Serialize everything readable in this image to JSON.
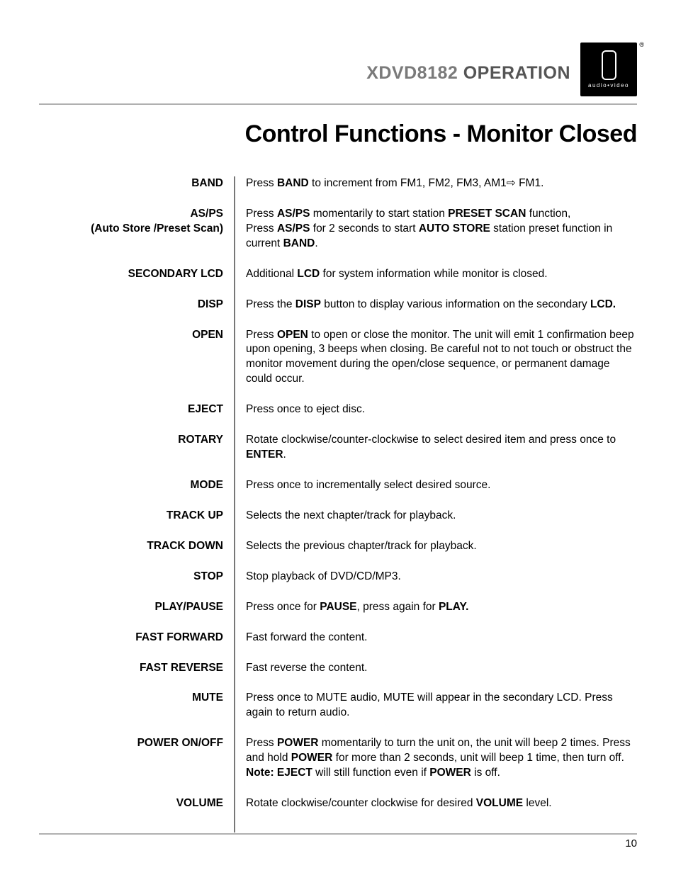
{
  "header": {
    "model": "XDVD8182",
    "section": "OPERATION",
    "logo_sub": "audio•video"
  },
  "title": "Control Functions - Monitor Closed",
  "rows": [
    {
      "label": "BAND",
      "desc": "Press <b>BAND</b> to increment from FM1, FM2, FM3, AM1<span class='arrow'>⇨</span> FM1."
    },
    {
      "label": "AS/PS<br><span class='sub'>(Auto Store /Preset Scan)</span>",
      "desc": "Press <b>AS/PS</b> momentarily to start station <b>PRESET SCAN</b> function,<br>Press <b>AS/PS</b> for 2 seconds to start <b>AUTO STORE</b> station preset function in current <b>BAND</b>."
    },
    {
      "label": "SECONDARY LCD",
      "desc": "Additional <b>LCD</b> for system information while monitor is closed."
    },
    {
      "label": "DISP",
      "desc": "Press the <b>DISP</b> button to display various information on the secondary <b>LCD.</b>"
    },
    {
      "label": "OPEN",
      "desc": "Press <b>OPEN</b> to open or close the monitor. The unit will emit 1 confirmation beep upon opening, 3 beeps when closing. Be careful not to not touch or obstruct the monitor movement during the open/close sequence, or permanent damage could occur."
    },
    {
      "label": "EJECT",
      "desc": "Press once to eject disc."
    },
    {
      "label": "ROTARY",
      "desc": "Rotate clockwise/counter-clockwise to select desired item and press once to <b>ENTER</b>."
    },
    {
      "label": "MODE",
      "desc": "Press once to incrementally select desired source."
    },
    {
      "label": "TRACK UP",
      "desc": "Selects the next chapter/track for playback."
    },
    {
      "label": "TRACK DOWN",
      "desc": "Selects the previous chapter/track for playback."
    },
    {
      "label": "STOP",
      "desc": "Stop playback of DVD/CD/MP3."
    },
    {
      "label": "PLAY/PAUSE",
      "desc": "Press once for <b>PAUSE</b>, press again for <b>PLAY.</b>"
    },
    {
      "label": "FAST FORWARD",
      "desc": "Fast forward the content."
    },
    {
      "label": "FAST REVERSE",
      "desc": "Fast reverse the content."
    },
    {
      "label": "MUTE",
      "desc": "Press once to MUTE audio, MUTE will appear in the secondary LCD. Press again to return audio."
    },
    {
      "label": "POWER ON/OFF",
      "desc": "Press <b>POWER</b> momentarily to turn the unit on, the unit will beep 2 times. Press and hold <b>POWER</b> for more than 2 seconds, unit will beep 1 time, then turn off. <b>Note: EJECT</b> will still function even if <b>POWER</b> is off."
    },
    {
      "label": "VOLUME",
      "desc": "Rotate clockwise/counter clockwise for desired <b>VOLUME</b> level."
    }
  ],
  "page_number": "10"
}
